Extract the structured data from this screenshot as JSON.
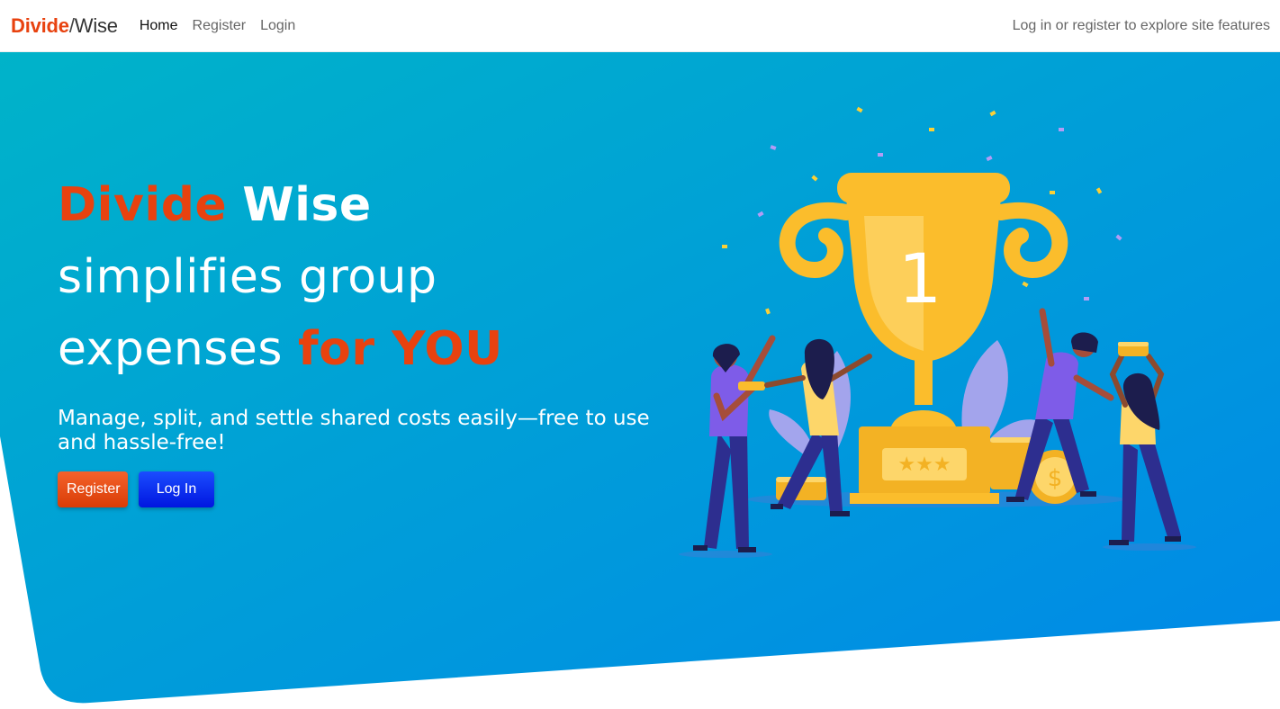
{
  "brand": {
    "part1": "Divide",
    "slash": "/",
    "part2": "Wise"
  },
  "nav": {
    "items": [
      {
        "label": "Home",
        "active": true
      },
      {
        "label": "Register",
        "active": false
      },
      {
        "label": "Login",
        "active": false
      }
    ],
    "right_text": "Log in or register to explore site features"
  },
  "hero": {
    "headline": {
      "line1_accent": "Divide",
      "line1_bold": "Wise",
      "line2": "simplifies group",
      "line3": "expenses",
      "line3_accent": "for YOU"
    },
    "subtitle": "Manage, split, and settle shared costs easily—free to use and hassle-free!",
    "buttons": {
      "register": "Register",
      "login": "Log In"
    }
  },
  "illustration": {
    "trophy_number": "1",
    "icons": [
      "trophy-icon",
      "coin-stack-icon",
      "confetti-icon",
      "people-celebrating-icon"
    ]
  },
  "colors": {
    "accent": "#e8420f",
    "hero_gradient_start": "#00b3c9",
    "hero_gradient_end": "#0088e8",
    "trophy_gold": "#fbbd2c",
    "login_button": "#0a2cf0"
  }
}
